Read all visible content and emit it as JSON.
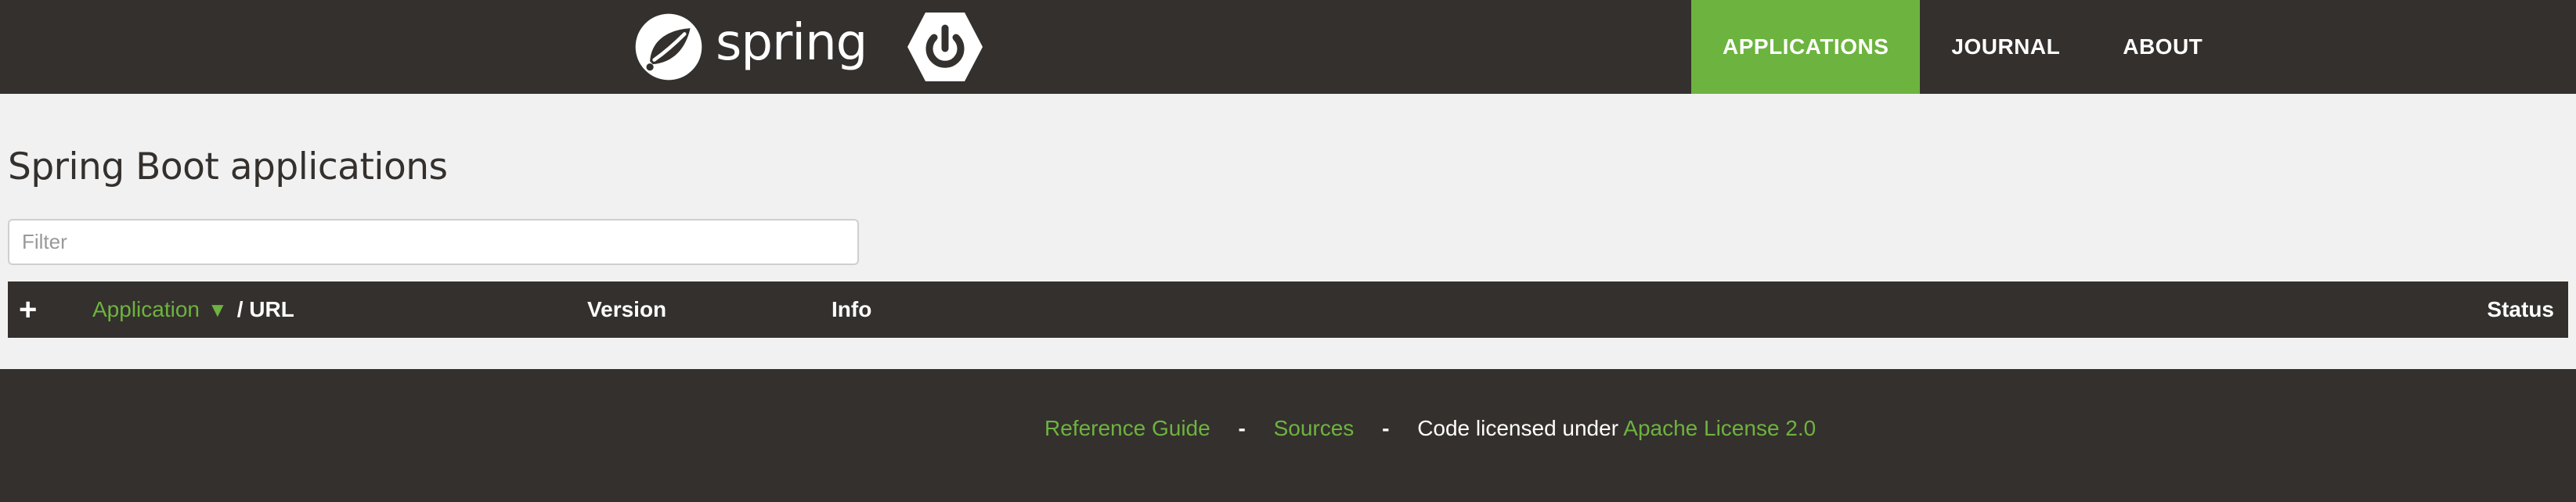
{
  "nav": {
    "brand_text": "spring",
    "items": [
      {
        "label": "APPLICATIONS",
        "active": true
      },
      {
        "label": "JOURNAL",
        "active": false
      },
      {
        "label": "ABOUT",
        "active": false
      }
    ],
    "active_color": "#6db33f",
    "bar_color": "#34302d"
  },
  "main": {
    "title": "Spring Boot applications",
    "filter": {
      "placeholder": "Filter",
      "value": ""
    },
    "table": {
      "add_symbol": "+",
      "columns": {
        "application": "Application",
        "sort_arrow": "▼",
        "url_sep": "/ URL",
        "version": "Version",
        "info": "Info",
        "status": "Status"
      }
    }
  },
  "footer": {
    "reference_guide": "Reference Guide",
    "dash1": "-",
    "sources": "Sources",
    "dash2": "-",
    "license_text": "Code licensed under ",
    "license_link": "Apache License 2.0"
  },
  "icons": {
    "logo": "spring-leaf-icon",
    "boot": "power-icon",
    "add": "plus-icon",
    "sort": "sort-down-icon"
  }
}
